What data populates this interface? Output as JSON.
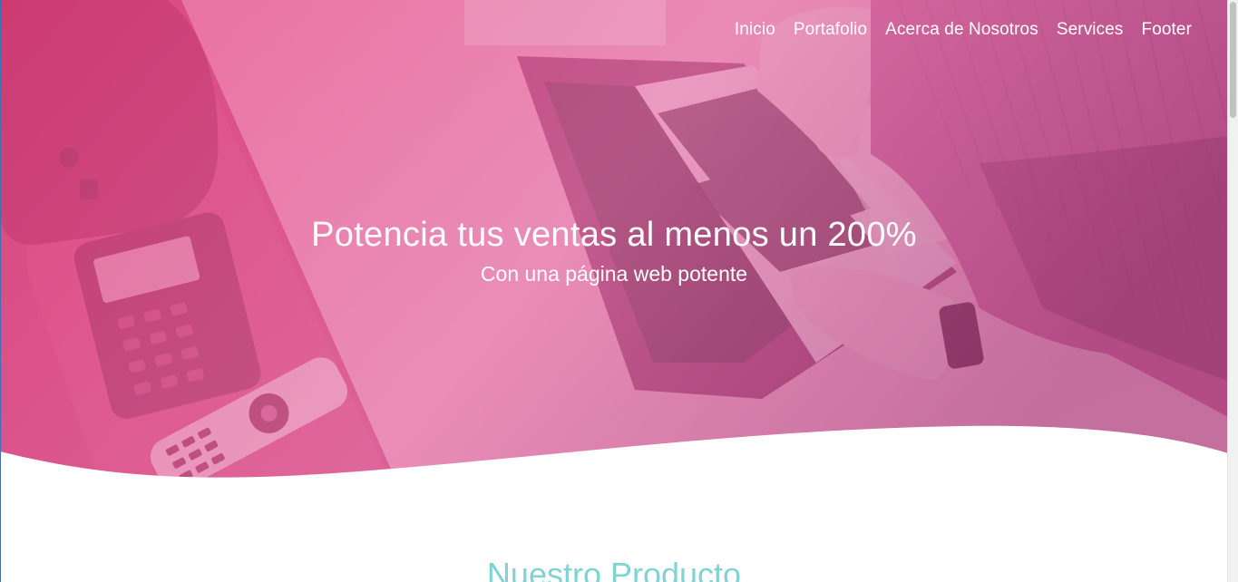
{
  "nav": {
    "items": [
      {
        "label": "Inicio"
      },
      {
        "label": "Portafolio"
      },
      {
        "label": "Acerca de Nosotros"
      },
      {
        "label": "Services"
      },
      {
        "label": "Footer"
      }
    ]
  },
  "hero": {
    "title": "Potencia tus ventas al menos un 200%",
    "subtitle": "Con una página web potente"
  },
  "section": {
    "title": "Nuestro Producto"
  },
  "colors": {
    "hero_overlay_left": "#e8487f",
    "hero_overlay_right": "#9c3a7a",
    "section_title": "#7fd3d3"
  }
}
